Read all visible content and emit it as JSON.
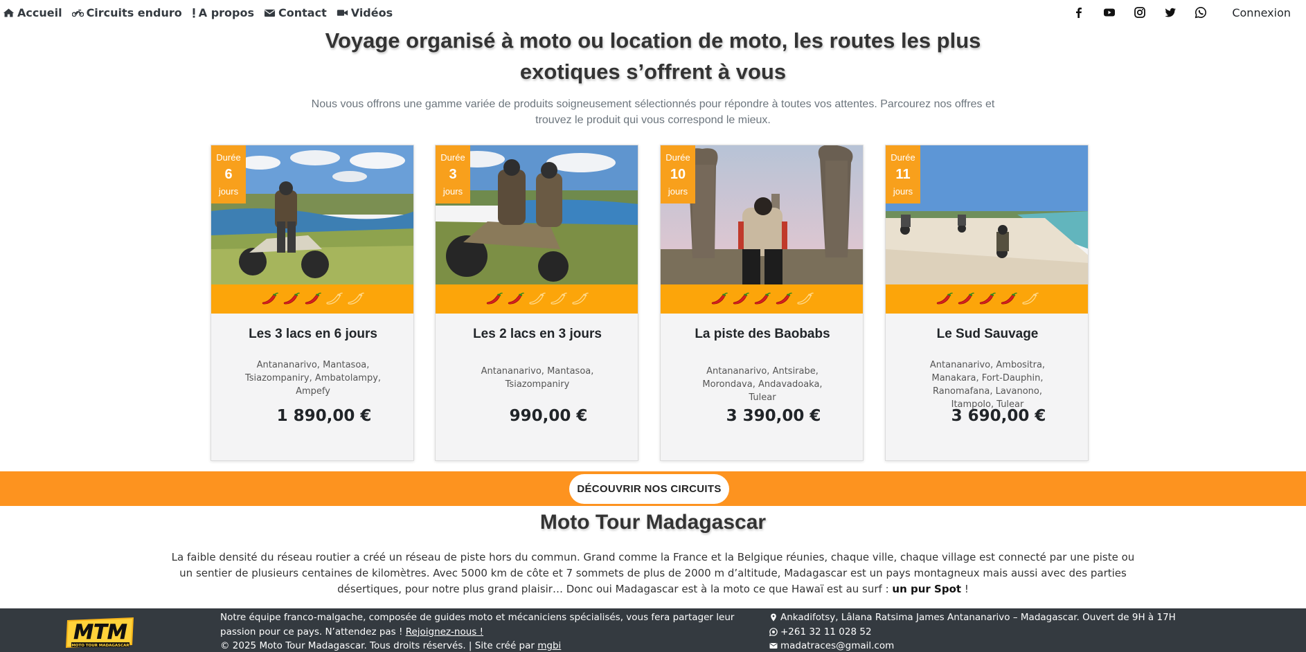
{
  "nav": {
    "items": [
      {
        "label": "Accueil",
        "icon": "home-icon"
      },
      {
        "label": "Circuits enduro",
        "icon": "motorcycle-icon"
      },
      {
        "label": "A propos",
        "icon": "exclamation-icon"
      },
      {
        "label": "Contact",
        "icon": "envelope-icon"
      },
      {
        "label": "Vidéos",
        "icon": "video-camera-icon"
      }
    ],
    "social": [
      "facebook-icon",
      "youtube-icon",
      "instagram-icon",
      "twitter-icon",
      "whatsapp-icon"
    ],
    "login_label": "Connexion"
  },
  "hero": {
    "title": "Voyage organisé à moto ou location de moto, les routes les plus exotiques s’offrent à vous",
    "subtitle": "Nous vous offrons une gamme variée de produits soigneusement sélectionnés pour répondre à toutes vos attentes. Parcourez nos offres et trouvez le produit qui vous correspond le mieux."
  },
  "cards": [
    {
      "duration_label": "Durée",
      "duration": "6",
      "duration_unit": "jours",
      "chili_rating": 3,
      "chili_max": 5,
      "title": "Les 3 lacs en 6 jours",
      "places": "Antananarivo, Mantasoa, Tsiazompaniry, Ambatolampy, Ampefy",
      "price": "1 890,00 €"
    },
    {
      "duration_label": "Durée",
      "duration": "3",
      "duration_unit": "jours",
      "chili_rating": 2,
      "chili_max": 5,
      "title": "Les 2 lacs en 3 jours",
      "places": "Antananarivo, Mantasoa, Tsiazompaniry",
      "price": "990,00 €"
    },
    {
      "duration_label": "Durée",
      "duration": "10",
      "duration_unit": "jours",
      "chili_rating": 4,
      "chili_max": 5,
      "title": "La piste des Baobabs",
      "places": "Antananarivo, Antsirabe, Morondava, Andavadoaka, Tulear",
      "price": "3 390,00 €"
    },
    {
      "duration_label": "Durée",
      "duration": "11",
      "duration_unit": "jours",
      "chili_rating": 4,
      "chili_max": 5,
      "title": "Le Sud Sauvage",
      "places": "Antananarivo, Ambositra, Manakara, Fort-Dauphin, Ranomafana, Lavanono, Itampolo, Tulear",
      "price": "3 690,00 €"
    }
  ],
  "cta": {
    "label": "DÉCOUVRIR NOS CIRCUITS"
  },
  "about": {
    "title": "Moto Tour Madagascar",
    "text": "La faible densité du réseau routier a créé un réseau de piste hors du commun. Grand comme la France et la Belgique réunies, chaque ville, chaque village est connecté par une piste ou un sentier de plusieurs centaines de kilomètres. Avec 5000 km de côte et 7 sommets de plus de 2000 m d’altitude, Madagascar est un pays montagneux mais aussi avec des parties désertiques, pour notre plus grand plaisir… Donc oui Madagascar est à la moto ce que Hawaï est au surf :",
    "emphasis": "un pur Spot",
    "end": " !"
  },
  "footer": {
    "logo_text": "MTM",
    "logo_subtext": "MOTO TOUR MADAGASCAR",
    "team_text": "Notre équipe franco-malgache, composée de guides moto et mécaniciens spécialisés, vous fera partager leur passion pour ce pays. N’attendez pas !",
    "join_link": "Rejoignez-nous !",
    "copyright": "© 2025 Moto Tour Madagascar. Tous droits réservés. | Site créé par",
    "creator_link": "mgbi",
    "address": "Ankadifotsy, Lâlana Ratsima James Antananarivo – Madagascar. Ouvert de 9H à 17H",
    "phone": "+261 32 11 028 52",
    "email": "madatraces@gmail.com"
  },
  "colors": {
    "accent_orange": "#fd931f",
    "badge_orange": "#f8a01c",
    "footer_bg": "#343a40"
  }
}
